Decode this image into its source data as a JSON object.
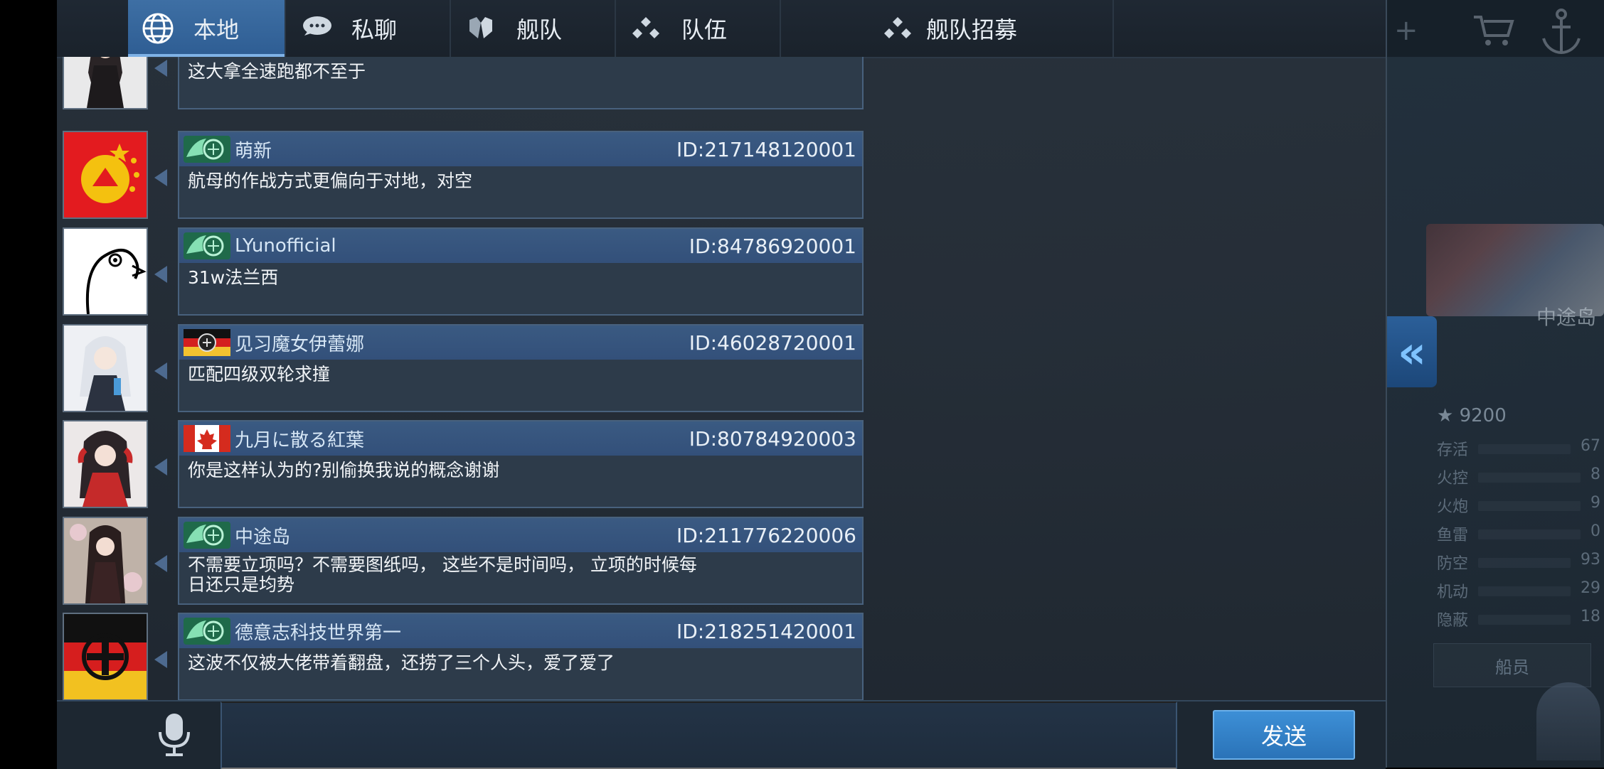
{
  "tabs": [
    {
      "label": "本地",
      "icon": "globe-icon",
      "active": true
    },
    {
      "label": "私聊",
      "icon": "chat-bubble-icon",
      "active": false
    },
    {
      "label": "舰队",
      "icon": "fleet-shield-icon",
      "active": false
    },
    {
      "label": "队伍",
      "icon": "team-dots-icon",
      "active": false
    },
    {
      "label": "舰队招募",
      "icon": "recruit-dots-icon",
      "active": false
    }
  ],
  "messages": [
    {
      "name": "",
      "id": "",
      "text": "这大拿全速跑都不至于",
      "avatar": "anime-girl-black-dress",
      "badge": "green-wing-emblem"
    },
    {
      "name": "萌新",
      "id": "ID:217148120001",
      "text": "航母的作战方式更偏向于对地，对空",
      "avatar": "red-yellow-star-emblem",
      "badge": "green-wing-emblem"
    },
    {
      "name": "LYunofficial",
      "id": "ID:84786920001",
      "text": "31w法兰西",
      "avatar": "duck-sketch",
      "badge": "green-wing-emblem"
    },
    {
      "name": "见习魔女伊蕾娜",
      "id": "ID:46028720001",
      "text": "匹配四级双轮求撞",
      "avatar": "white-hair-anime-girl",
      "badge": "german-flag-emblem"
    },
    {
      "name": "九月に散る紅葉",
      "id": "ID:80784920003",
      "text": "你是这样认为的?别偷换我说的概念谢谢",
      "avatar": "dark-hair-headphones-girl",
      "badge": "canada-flag-emblem"
    },
    {
      "name": "中途岛",
      "id": "ID:211776220006",
      "text": "不需要立项吗？不需要图纸吗， 这些不是时间吗， 立项的时候每\n日还只是均势",
      "avatar": "flower-anime-girl",
      "badge": "green-wing-emblem"
    },
    {
      "name": "德意志科技世界第一",
      "id": "ID:218251420001",
      "text": "这波不仅被大佬带着翻盘，还捞了三个人头，爱了爱了",
      "avatar": "iron-cross-emblem",
      "badge": "green-wing-emblem"
    }
  ],
  "input": {
    "placeholder": "",
    "value": ""
  },
  "send_label": "发送",
  "background": {
    "ship_name": "中途岛",
    "rating": "9200",
    "stats": [
      {
        "label": "存活",
        "value": "67"
      },
      {
        "label": "火控",
        "value": "8"
      },
      {
        "label": "火炮",
        "value": "9"
      },
      {
        "label": "鱼雷",
        "value": "0"
      },
      {
        "label": "防空",
        "value": "93"
      },
      {
        "label": "机动",
        "value": "29"
      },
      {
        "label": "隐蔽",
        "value": "18"
      }
    ],
    "crew_label": "船员"
  },
  "colors": {
    "accent": "#2e5d93",
    "send": "#2a73b8",
    "panel": "#28313b"
  }
}
